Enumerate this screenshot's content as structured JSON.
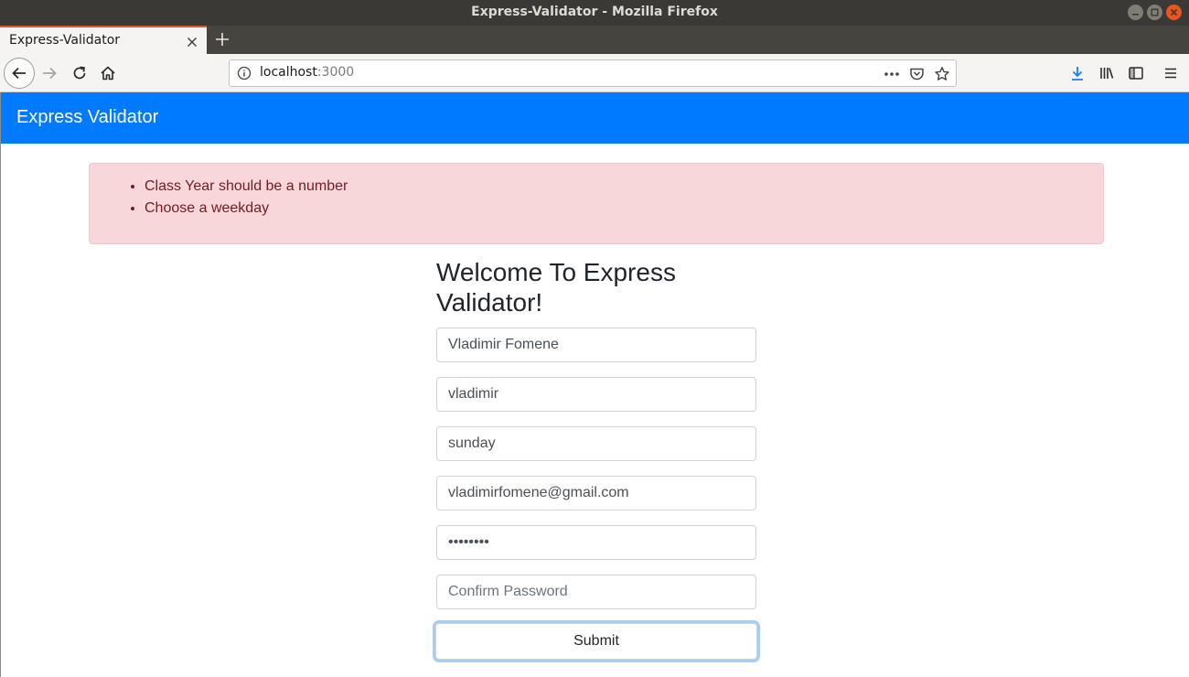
{
  "window": {
    "title": "Express-Validator - Mozilla Firefox"
  },
  "tab": {
    "title": "Express-Validator"
  },
  "urlbar": {
    "host": "localhost",
    "port": ":3000"
  },
  "app": {
    "brand": "Express Validator"
  },
  "errors": [
    "Class Year should be a number",
    "Choose a weekday"
  ],
  "form": {
    "heading": "Welcome To Express Validator!",
    "fields": [
      {
        "name": "fullname-input",
        "type": "text",
        "value": "Vladimir Fomene",
        "placeholder": ""
      },
      {
        "name": "username-input",
        "type": "text",
        "value": "vladimir",
        "placeholder": ""
      },
      {
        "name": "weekday-input",
        "type": "text",
        "value": "sunday",
        "placeholder": ""
      },
      {
        "name": "email-input",
        "type": "text",
        "value": "vladimirfomene@gmail.com",
        "placeholder": ""
      },
      {
        "name": "password-input",
        "type": "password",
        "value": "password",
        "placeholder": ""
      },
      {
        "name": "confirm-password-input",
        "type": "password",
        "value": "",
        "placeholder": "Confirm Password"
      }
    ],
    "submit_label": "Submit"
  }
}
